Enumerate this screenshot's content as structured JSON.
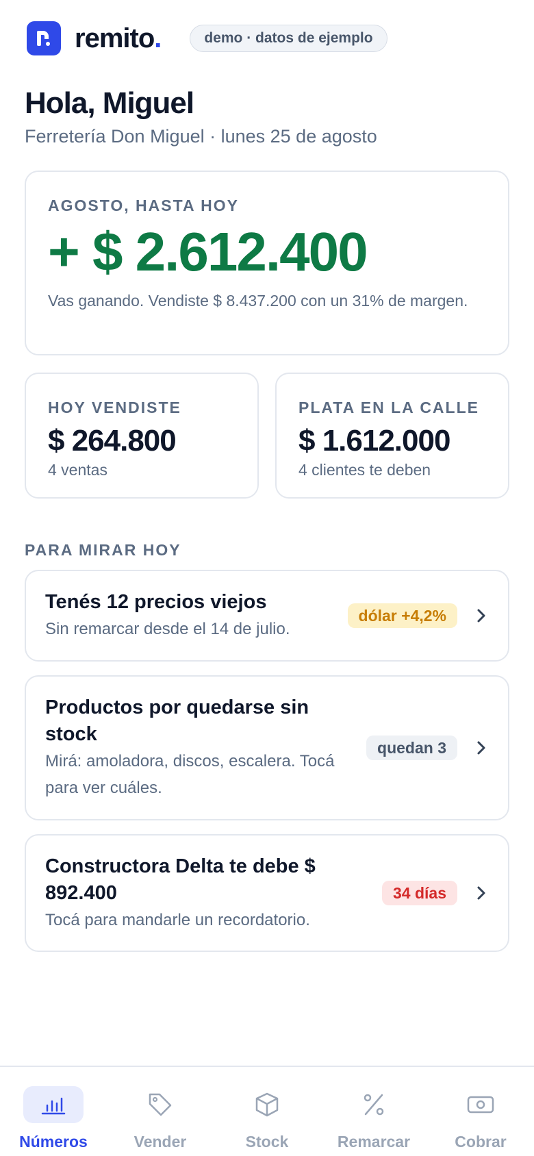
{
  "brand": {
    "name": "remito",
    "dot": ".",
    "demo_pill": "demo · datos de ejemplo",
    "accent": "#2f49e8"
  },
  "greeting": {
    "title": "Hola, Miguel",
    "subtitle": "Ferretería Don Miguel · lunes 25 de agosto"
  },
  "month_card": {
    "eyebrow": "AGOSTO, HASTA HOY",
    "amount": "+ $ 2.612.400",
    "description": "Vas ganando. Vendiste $ 8.437.200 con un 31% de margen.",
    "amount_color": "#0e7a45"
  },
  "stats": {
    "today": {
      "eyebrow": "HOY VENDISTE",
      "value": "$ 264.800",
      "sub": "4 ventas"
    },
    "receivables": {
      "eyebrow": "PLATA EN LA CALLE",
      "value": "$ 1.612.000",
      "sub": "4 clientes te deben"
    }
  },
  "section": {
    "title": "PARA MIRAR HOY"
  },
  "todos": [
    {
      "title": "Tenés 12 precios viejos",
      "desc": "Sin remarcar desde el 14 de julio.",
      "badge": "dólar +4,2%",
      "badge_bg": "#fdf1c7",
      "badge_fg": "#c77d05"
    },
    {
      "title": "Productos por quedarse sin stock",
      "desc": "Mirá: amoladora, discos, escalera. Tocá para ver cuáles.",
      "badge": "quedan 3",
      "badge_bg": "#eef1f5",
      "badge_fg": "#475569"
    },
    {
      "title": "Constructora Delta te debe $ 892.400",
      "desc": "Tocá para mandarle un recordatorio.",
      "badge": "34 días",
      "badge_bg": "#fde4e4",
      "badge_fg": "#d42a2a"
    }
  ],
  "nav": [
    {
      "label": "Números",
      "icon": "bar-chart-icon",
      "active": true
    },
    {
      "label": "Vender",
      "icon": "tag-icon",
      "active": false
    },
    {
      "label": "Stock",
      "icon": "box-icon",
      "active": false
    },
    {
      "label": "Remarcar",
      "icon": "percent-icon",
      "active": false
    },
    {
      "label": "Cobrar",
      "icon": "cash-icon",
      "active": false
    }
  ]
}
